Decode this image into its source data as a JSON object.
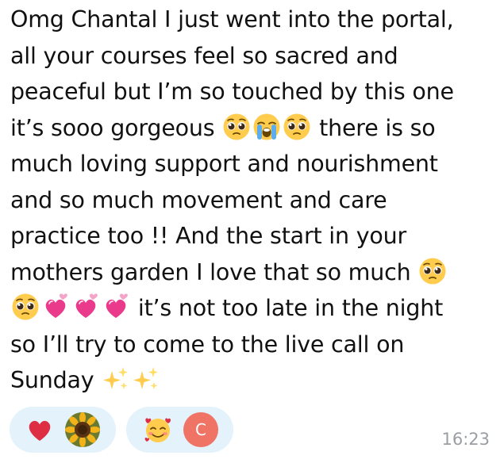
{
  "message": {
    "lines": [
      "Omg Chantal I just went into the portal,",
      "all your courses feel so sacred and",
      "peaceful but I’m so touched by this one",
      "it’s sooo gorgeous",
      "there is so",
      "much loving support and nourishment",
      "and so much movement and care",
      "practice too !! And the start in your",
      "mothers garden I love that so much",
      "it’s not too late in the night",
      "so I’ll try to come to the live call on",
      "Sunday"
    ],
    "timestamp": "16:23"
  },
  "emojis": {
    "pleading": "pleading-face",
    "crying": "loudly-crying-face",
    "hearts": "two-hearts",
    "sparkles": "sparkles"
  },
  "reactions": [
    {
      "emoji": "red-heart",
      "reactor": "sunflower-avatar"
    },
    {
      "emoji": "smiling-face-with-hearts",
      "reactor": "C"
    }
  ],
  "colors": {
    "bubble": "#ffffff",
    "text": "#111111",
    "reaction_pill": "#e3f2fb",
    "avatar_c": "#f07466",
    "timestamp": "#9a9ea3"
  }
}
